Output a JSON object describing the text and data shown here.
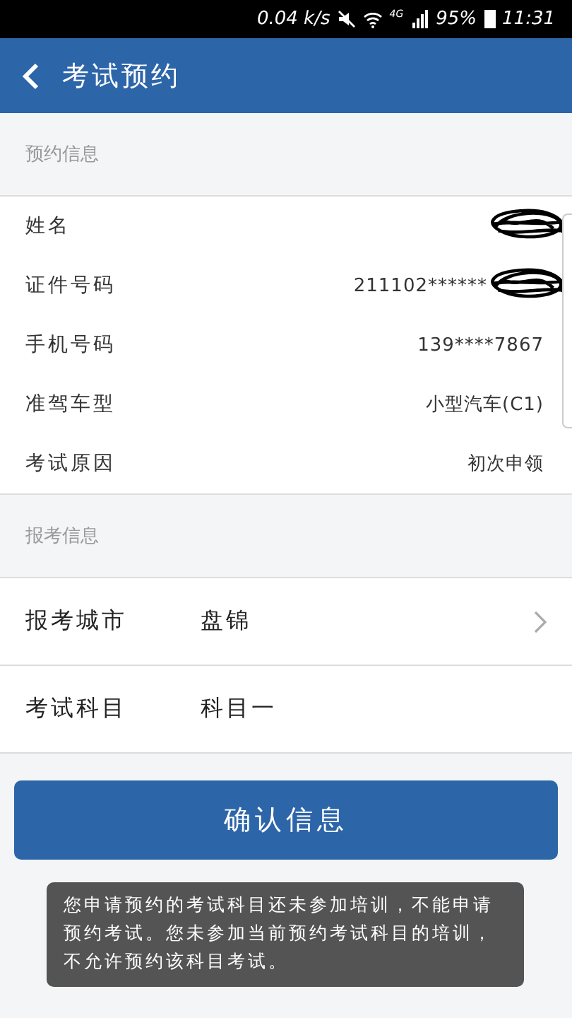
{
  "status_bar": {
    "speed": "0.04 k/s",
    "network": "4G",
    "battery": "95%",
    "time": "11:31"
  },
  "header": {
    "title": "考试预约"
  },
  "sections": [
    {
      "title": "预约信息",
      "rows": [
        {
          "kind": "info",
          "label": "姓名",
          "redacted": true
        },
        {
          "kind": "info",
          "label": "证件号码",
          "value": "211102******",
          "redacted": true
        },
        {
          "kind": "info",
          "label": "手机号码",
          "value": "139****7867",
          "redacted": false
        },
        {
          "kind": "info",
          "label": "准驾车型",
          "value": "小型汽车(C1)",
          "redacted": false
        },
        {
          "kind": "info",
          "label": "考试原因",
          "value": "初次申领",
          "redacted": false
        }
      ]
    },
    {
      "title": "报考信息",
      "rows": [
        {
          "kind": "select",
          "label": "报考城市",
          "value": "盘锦"
        },
        {
          "kind": "field",
          "label": "考试科目",
          "value": "科目一"
        }
      ]
    }
  ],
  "button": "确认信息",
  "toast": "您申请预约的考试科目还未参加培训，不能申请预约考试。您未参加当前预约考试科目的培训，不允许预约该科目考试。"
}
